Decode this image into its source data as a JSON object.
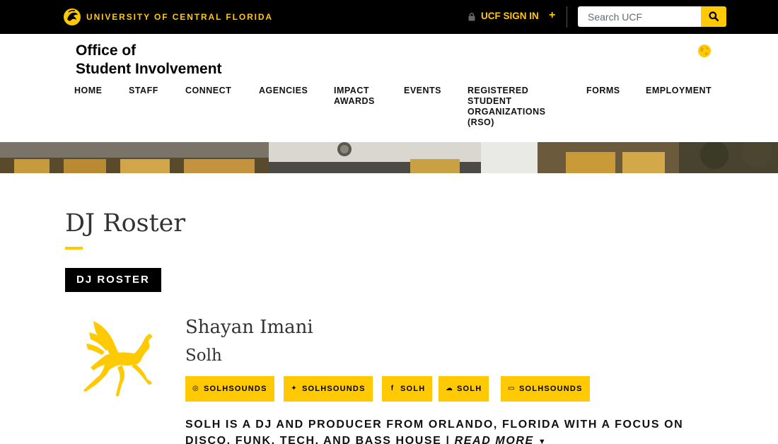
{
  "topbar": {
    "university_name": "UNIVERSITY OF CENTRAL FLORIDA",
    "signin_prefix": "UCF",
    "signin_label": "SIGN IN",
    "plus": "+",
    "search_placeholder": "Search UCF"
  },
  "header": {
    "title_line1": "Office of",
    "title_line2": "Student Involvement"
  },
  "nav": {
    "items": [
      {
        "label": "HOME"
      },
      {
        "label": "STAFF"
      },
      {
        "label": "CONNECT"
      },
      {
        "label": "AGENCIES"
      },
      {
        "label": "IMPACT\nAWARDS"
      },
      {
        "label": "EVENTS"
      },
      {
        "label": "REGISTERED\nSTUDENT\nORGANIZATIONS\n(RSO)"
      },
      {
        "label": "FORMS"
      },
      {
        "label": "EMPLOYMENT"
      }
    ]
  },
  "main": {
    "page_title": "DJ Roster",
    "section_badge": "DJ ROSTER",
    "dj": {
      "name": "Shayan Imani",
      "alias": "Solh",
      "socials": [
        {
          "icon": "instagram-icon",
          "glyph": "◎",
          "label": "SOLHSOUNDS"
        },
        {
          "icon": "twitter-icon",
          "glyph": "✦",
          "label": "SOLHSOUNDS"
        },
        {
          "icon": "facebook-icon",
          "glyph": "f",
          "label": "SOLH"
        },
        {
          "icon": "soundcloud-icon",
          "glyph": "☁",
          "label": "SOLH"
        },
        {
          "icon": "twitch-icon",
          "glyph": "▭",
          "label": "SOLHSOUNDS"
        }
      ],
      "bio": "SOLH IS A DJ AND PRODUCER FROM ORLANDO, FLORIDA WITH A FOCUS ON DISCO, FUNK, TECH, AND BASS HOUSE |",
      "read_more": "READ MORE"
    }
  },
  "colors": {
    "ucf_gold": "#ffc904",
    "black": "#000000"
  }
}
